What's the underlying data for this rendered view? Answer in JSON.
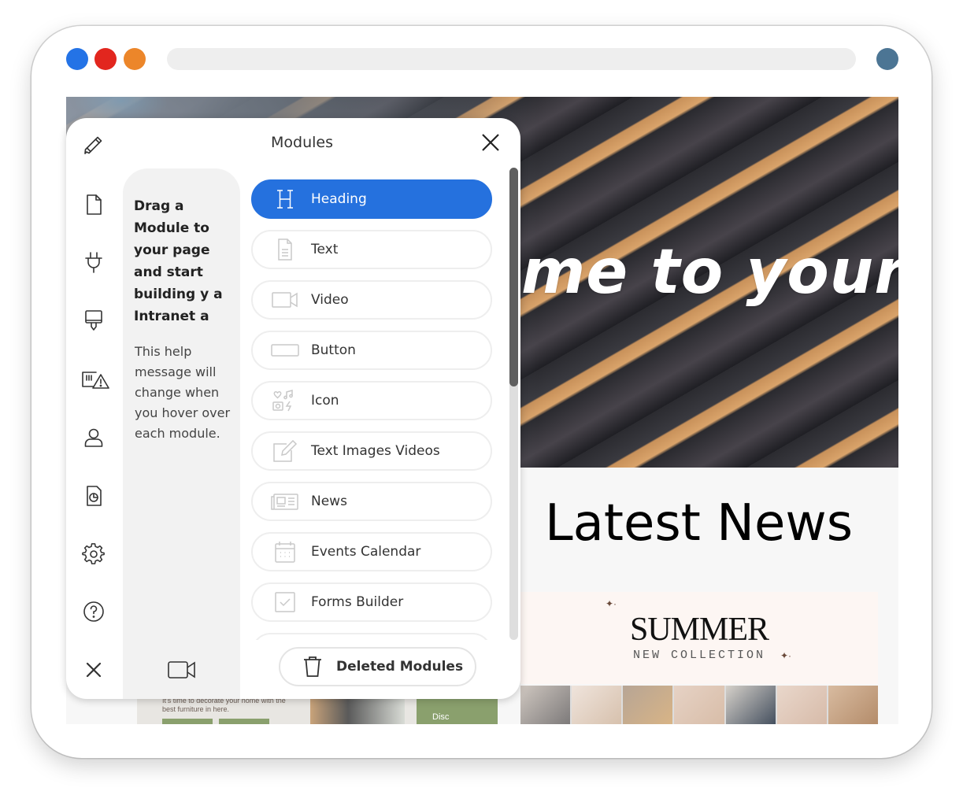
{
  "browser": {
    "window_dots": [
      {
        "name": "close",
        "color": "#2473e6"
      },
      {
        "name": "minimize",
        "color": "#e2261e"
      },
      {
        "name": "maximize",
        "color": "#ec862a"
      }
    ],
    "avatar_color": "#4c7594"
  },
  "page": {
    "hero_text": "me to your",
    "latest_news_title": "Latest News",
    "summer_banner": {
      "title": "SUMMER",
      "subtitle": "NEW COLLECTION"
    },
    "behind_panel_text": "It's time to decorate your home with the best furniture in here.",
    "behind_panel_badge": "Disc"
  },
  "panel": {
    "title": "Modules",
    "rail_icons": [
      {
        "name": "pencil-icon",
        "label": "Edit"
      },
      {
        "name": "page-icon",
        "label": "Pages"
      },
      {
        "name": "plug-icon",
        "label": "Plugins"
      },
      {
        "name": "paint-brush-icon",
        "label": "Theme"
      },
      {
        "name": "alert-icon",
        "label": "Alerts"
      },
      {
        "name": "user-icon",
        "label": "Users"
      },
      {
        "name": "report-icon",
        "label": "Reports"
      },
      {
        "name": "gear-icon",
        "label": "Settings"
      },
      {
        "name": "help-icon",
        "label": "Help"
      },
      {
        "name": "close-icon",
        "label": "Close"
      }
    ],
    "help": {
      "bold": "Drag a Module to your page and start building y a Intranet a",
      "bold_lines": [
        "Drag a",
        "Module to",
        "your page",
        "and start",
        "building y a",
        "Intranet  a"
      ],
      "normal": "This help message will change when you hover over each module.",
      "normal_lines": [
        "This help",
        "message will",
        "change when",
        "you hover over",
        "each module."
      ]
    },
    "modules": [
      {
        "label": "Heading",
        "icon": "heading-icon",
        "active": true
      },
      {
        "label": "Text",
        "icon": "text-doc-icon",
        "active": false
      },
      {
        "label": "Video",
        "icon": "video-icon",
        "active": false
      },
      {
        "label": "Button",
        "icon": "button-icon",
        "active": false
      },
      {
        "label": "Icon",
        "icon": "icon-set-icon",
        "active": false
      },
      {
        "label": "Text Images Videos",
        "icon": "edit-icon",
        "active": false
      },
      {
        "label": "News",
        "icon": "news-icon",
        "active": false
      },
      {
        "label": "Events Calendar",
        "icon": "calendar-icon",
        "active": false
      },
      {
        "label": "Forms Builder",
        "icon": "checkbox-icon",
        "active": false
      }
    ],
    "deleted_modules_label": "Deleted Modules",
    "accent_color": "#2571de"
  }
}
